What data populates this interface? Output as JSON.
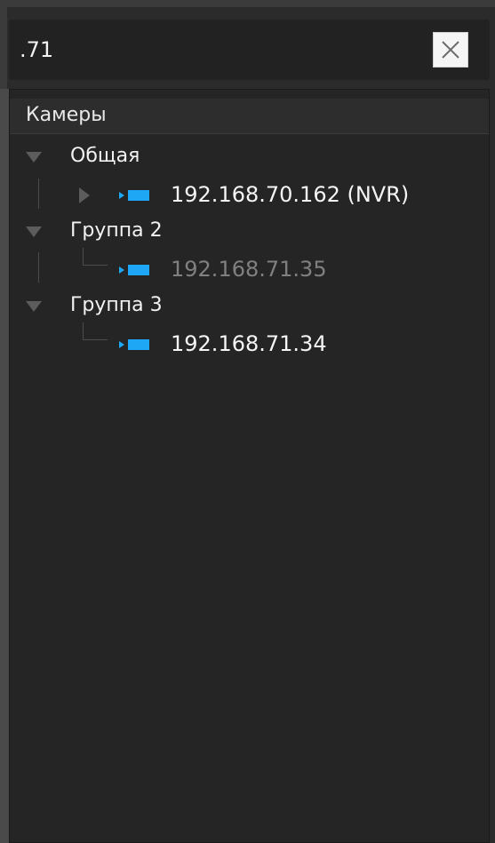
{
  "search": {
    "value": ".71",
    "clear_icon": "close-icon"
  },
  "tree": {
    "header": "Камеры",
    "groups": [
      {
        "name": "Общая",
        "expanded": true,
        "items": [
          {
            "label": "192.168.70.162 (NVR)",
            "icon": "camera-icon",
            "expandable": true,
            "state": "online"
          }
        ]
      },
      {
        "name": "Группа 2",
        "expanded": true,
        "items": [
          {
            "label": "192.168.71.35",
            "icon": "camera-icon",
            "expandable": false,
            "state": "offline"
          }
        ]
      },
      {
        "name": "Группа 3",
        "expanded": true,
        "items": [
          {
            "label": "192.168.71.34",
            "icon": "camera-icon",
            "expandable": false,
            "state": "online"
          }
        ]
      }
    ]
  },
  "colors": {
    "background": "#252525",
    "camera_icon": "#1ea7f5",
    "text_active": "#f5f5f5",
    "text_dim": "#808080",
    "tree_arrow": "#5c5c5c"
  }
}
